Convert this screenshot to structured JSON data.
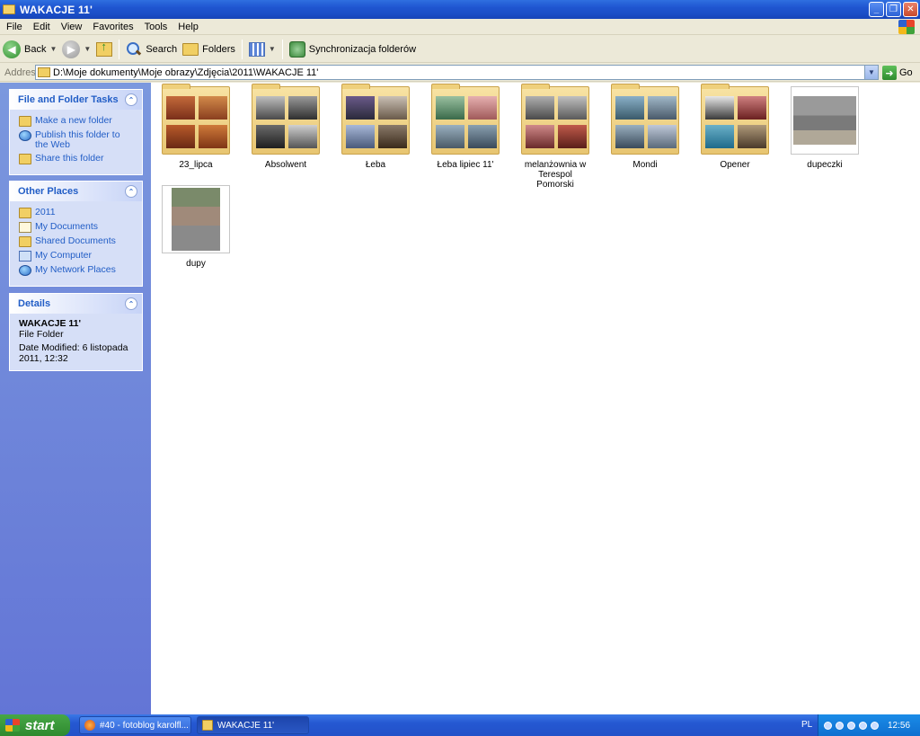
{
  "window": {
    "title": "WAKACJE 11'",
    "controls": [
      "minimize",
      "restore",
      "close"
    ]
  },
  "menu": {
    "items": [
      "File",
      "Edit",
      "View",
      "Favorites",
      "Tools",
      "Help"
    ]
  },
  "toolbar": {
    "back_label": "Back",
    "search_label": "Search",
    "folders_label": "Folders",
    "sync_label": "Synchronizacja folderów"
  },
  "address": {
    "label": "Address",
    "value": "D:\\Moje dokumenty\\Moje obrazy\\Zdjęcia\\2011\\WAKACJE 11'",
    "go_label": "Go"
  },
  "sidebar": {
    "tasks": {
      "title": "File and Folder Tasks",
      "items": [
        {
          "label": "Make a new folder",
          "icon": "new-folder-icon"
        },
        {
          "label": "Publish this folder to the Web",
          "icon": "globe-icon"
        },
        {
          "label": "Share this folder",
          "icon": "share-folder-icon"
        }
      ]
    },
    "places": {
      "title": "Other Places",
      "items": [
        {
          "label": "2011",
          "icon": "folder-icon"
        },
        {
          "label": "My Documents",
          "icon": "documents-icon"
        },
        {
          "label": "Shared Documents",
          "icon": "folder-icon"
        },
        {
          "label": "My Computer",
          "icon": "computer-icon"
        },
        {
          "label": "My Network Places",
          "icon": "network-icon"
        }
      ]
    },
    "details": {
      "title": "Details",
      "name": "WAKACJE 11'",
      "type": "File Folder",
      "modified": "Date Modified: 6 listopada 2011, 12:32"
    }
  },
  "files": [
    {
      "name": "23_lipca",
      "kind": "folder"
    },
    {
      "name": "Absolwent",
      "kind": "folder"
    },
    {
      "name": "Łeba",
      "kind": "folder"
    },
    {
      "name": "Łeba lipiec 11'",
      "kind": "folder"
    },
    {
      "name": "melanżownia w Terespol Pomorski",
      "kind": "folder"
    },
    {
      "name": "Mondi",
      "kind": "folder"
    },
    {
      "name": "Opener",
      "kind": "folder"
    },
    {
      "name": "dupeczki",
      "kind": "image"
    },
    {
      "name": "dupy",
      "kind": "image"
    }
  ],
  "taskbar": {
    "start_label": "start",
    "items": [
      {
        "label": "#40 - fotoblog karolfl...",
        "active": false
      },
      {
        "label": "WAKACJE 11'",
        "active": true
      }
    ],
    "language": "PL",
    "clock": "12:56"
  },
  "colors": {
    "titlebar": "#1f55d0",
    "sidebar": "#6f87da",
    "link": "#215dc6",
    "taskbar": "#2558d2",
    "start": "#3a9a3a"
  }
}
